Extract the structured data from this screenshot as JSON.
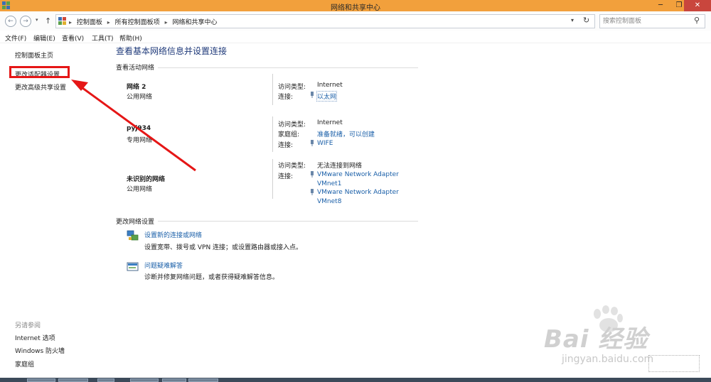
{
  "window": {
    "title": "网络和共享中心",
    "min_glyph": "─",
    "max_glyph": "❐",
    "close_glyph": "✕"
  },
  "nav": {
    "back_glyph": "←",
    "forward_glyph": "→",
    "recent_glyph": "▾",
    "up_glyph": "↑",
    "dropdown_glyph": "▾",
    "refresh_glyph": "↻"
  },
  "breadcrumbs": [
    "控制面板",
    "所有控制面板项",
    "网络和共享中心"
  ],
  "breadcrumb_sep": "▸",
  "search": {
    "placeholder": "搜索控制面板",
    "icon_glyph": "⚲"
  },
  "menu": [
    "文件(F)",
    "编辑(E)",
    "查看(V)",
    "工具(T)",
    "帮助(H)"
  ],
  "sidebar": {
    "items": [
      "控制面板主页",
      "更改适配器设置",
      "更改高级共享设置"
    ],
    "see_also_title": "另请参阅",
    "see_also": [
      "Internet 选项",
      "Windows 防火墙",
      "家庭组"
    ]
  },
  "main": {
    "title": "查看基本网络信息并设置连接",
    "active_networks_title": "查看活动网络",
    "networks": [
      {
        "name": "网络  2",
        "type": "公用网络",
        "access_label": "访问类型:",
        "access_value": "Internet",
        "conn_label": "连接:",
        "conn_value": "以太网"
      },
      {
        "name": "pyj934",
        "type": "专用网络",
        "access_label": "访问类型:",
        "access_value": "Internet",
        "homegroup_label": "家庭组:",
        "homegroup_value": "准备就绪，可以创建",
        "conn_label": "连接:",
        "conn_value": "WIFE"
      },
      {
        "name": "未识别的网络",
        "type": "公用网络",
        "access_label": "访问类型:",
        "access_value": "无法连接到网络",
        "conn_label": "连接:",
        "adapters": [
          {
            "line1": "VMware Network Adapter",
            "line2": "VMnet1"
          },
          {
            "line1": "VMware Network Adapter",
            "line2": "VMnet8"
          }
        ]
      }
    ],
    "change_settings_title": "更改网络设置",
    "actions": [
      {
        "link": "设置新的连接或网络",
        "desc": "设置宽带、拨号或 VPN 连接；或设置路由器或接入点。"
      },
      {
        "link": "问题疑难解答",
        "desc": "诊断并修复网络问题，或者获得疑难解答信息。"
      }
    ]
  },
  "watermark": {
    "brand": "Bai  经验",
    "url": "jingyan.baidu.com"
  },
  "colors": {
    "titlebar": "#f2a03c",
    "link": "#1a5fa8",
    "title": "#1f3a7a",
    "annotation": "#e51616",
    "close": "#c9463d"
  }
}
